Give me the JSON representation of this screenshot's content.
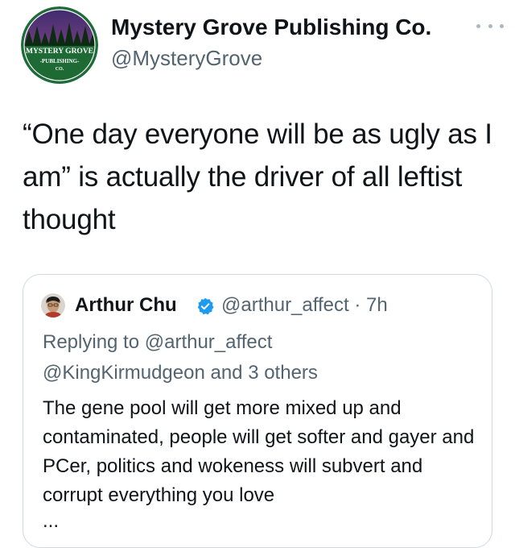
{
  "tweet": {
    "author": {
      "name": "Mystery Grove Publishing Co.",
      "handle": "@MysteryGrove",
      "avatar_text": {
        "line1": "MYSTERY GROVE",
        "line2": "-PUBLISHING-",
        "line3": "CO."
      },
      "avatar_colors": {
        "ring": "#1f6b3a",
        "sky_top": "#3b2a6e",
        "sky_bottom": "#a5538f",
        "trees": "#0d2a12",
        "banner": "#1d6a34"
      }
    },
    "more_icon": "more-horizontal-icon",
    "text": "“One day everyone will be as ugly as I am” is actually the driver of all leftist thought"
  },
  "quoted_tweet": {
    "author": {
      "name": "Arthur Chu",
      "handle": "@arthur_affect",
      "timestamp": "· 7h",
      "verified": true
    },
    "replying_line1": "Replying to @arthur_affect",
    "replying_line2": "@KingKirmudgeon and 3 others",
    "text": "The gene pool will get more mixed up and contaminated, people will get softer and gayer and PCer, politics and wokeness will subvert and corrupt everything you love",
    "truncation": "...",
    "verified_color": "#1d9bf0"
  },
  "colors": {
    "primary_text": "#0f1419",
    "secondary_text": "#536471",
    "border": "#cfd9de"
  }
}
